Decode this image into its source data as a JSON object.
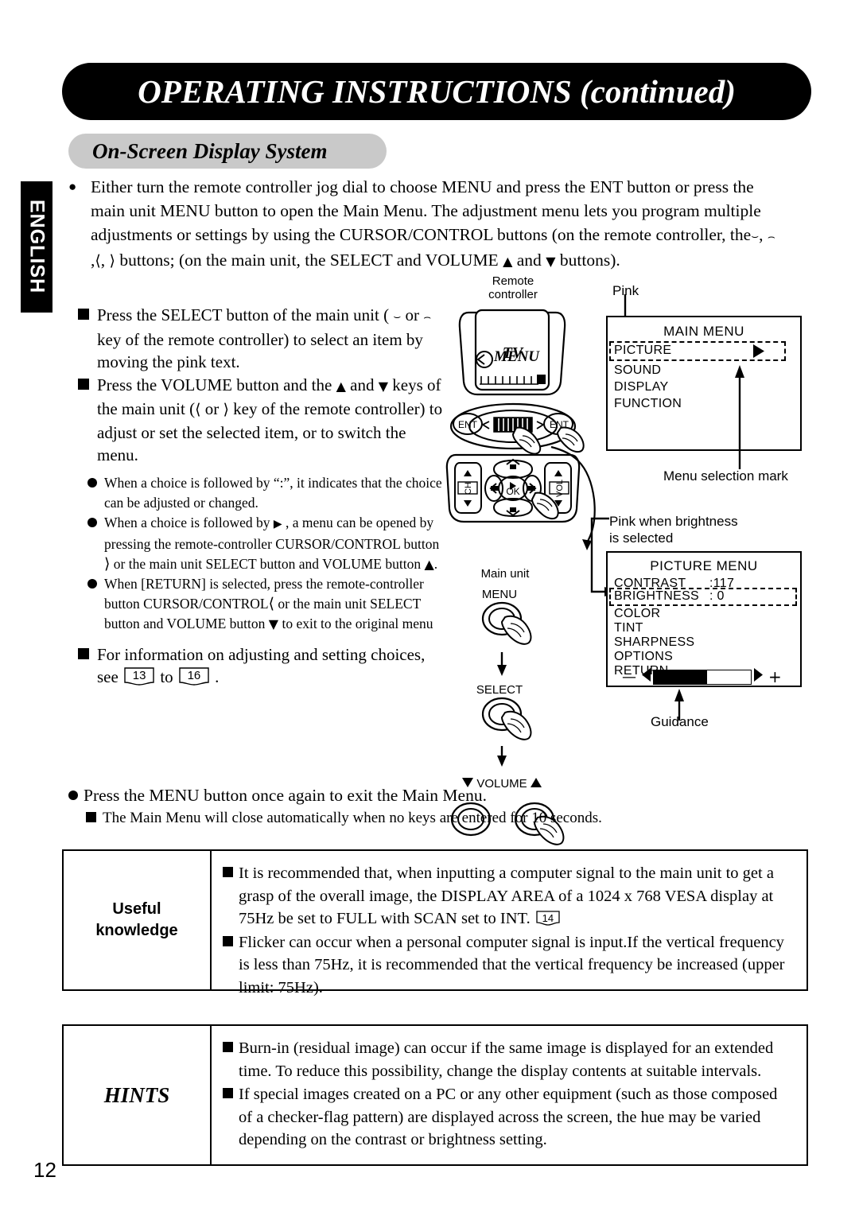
{
  "header": {
    "title_main": "OPERATING INSTRUCTIONS",
    "title_continued": " (continued)",
    "section_title": "On-Screen Display System",
    "language_tab": "ENGLISH",
    "page_number": "12"
  },
  "intro": {
    "line1": "Either turn the remote controller jog dial to choose  MENU and press the ENT button or press the",
    "line2": "main unit MENU button to open the Main Menu.  The adjustment menu lets you program multiple",
    "line3_a": "adjustments or settings by using the CURSOR/CONTROL buttons (on the remote controller, the",
    "line3_b": ",",
    "line4_a": ",",
    "line4_b": ", ",
    "line4_c": " buttons; (on the main unit, the SELECT and VOLUME ",
    "line4_d": " and ",
    "line4_e": " buttons)."
  },
  "left_column": {
    "item1": "Press the SELECT button of the main unit ( ⌒ or ⌄ key of the remote controller) to select an item by moving the pink text.",
    "item1_p1": "Press the SELECT button of the main unit ( ",
    "item1_p2": " or ",
    "item1_p3": " key of the remote controller) to select an item by moving the pink text.",
    "item2_p1": "Press the VOLUME button and the ",
    "item2_p2": " and ",
    "item2_p3": " keys of the main unit (",
    "item2_p4": " or ",
    "item2_p5": " key of the remote controller) to adjust or set the selected item, or to switch the menu.",
    "sub1": "When a choice is followed by “:”, it indicates that the choice can be adjusted or changed.",
    "sub2_p1": "When a choice is followed by ",
    "sub2_p2": " , a menu can be opened by pressing the remote-controller CURSOR/CONTROL button ",
    "sub2_p3": " or the main unit SELECT button and VOLUME button ",
    "sub2_p4": ".",
    "sub3_p1": "When [RETURN] is selected, press the remote-controller button CURSOR/CONTROL",
    "sub3_p2": " or the main unit SELECT button and VOLUME button ",
    "sub3_p3": " to exit to the original menu",
    "item3_p1": "For information on adjusting and setting choices, see ",
    "item3_ref1": "13",
    "item3_mid": " to ",
    "item3_ref2": "16",
    "item3_p2": " ."
  },
  "diagram": {
    "remote_label_line1": "Remote",
    "remote_label_line2": "controller",
    "remote_screen_tv": "TV",
    "remote_screen_menu": "MENU",
    "btn_ent_left": "ENT",
    "btn_ent_right": "ENT",
    "btn_ch": "CH",
    "btn_vol": "VOL",
    "btn_ok": "OK",
    "main_unit_label": "Main unit",
    "main_menu_btn": "MENU",
    "main_select_btn": "SELECT",
    "main_volume_btn": "VOLUME"
  },
  "osd": {
    "pink_label": "Pink",
    "menu_selection_mark_label": "Menu selection mark",
    "pink_brightness_label_line1": "Pink when brightness",
    "pink_brightness_label_line2": "is selected",
    "guidance_label": "Guidance",
    "main_menu": {
      "title": "MAIN MENU",
      "items": [
        "PICTURE",
        "SOUND",
        "DISPLAY",
        "FUNCTION"
      ],
      "selected_index": 0,
      "selected_has_arrow": true
    },
    "picture_menu": {
      "title": "PICTURE MENU",
      "rows": [
        {
          "name": "CONTRAST",
          "value": ":117"
        },
        {
          "name": "BRIGHTNESS",
          "value": ":   0"
        },
        {
          "name": "COLOR",
          "value": ""
        },
        {
          "name": "TINT",
          "value": ""
        },
        {
          "name": "SHARPNESS",
          "value": ""
        },
        {
          "name": "OPTIONS",
          "value": ""
        },
        {
          "name": "RETURN",
          "value": ""
        }
      ],
      "selected_index": 1,
      "slider_minus": "—",
      "slider_plus": "+",
      "slider_fill_percent": 55
    }
  },
  "exit_note": {
    "main": "Press the MENU button once again to exit the Main Menu.",
    "sub": "The Main Menu will close automatically when no keys are entered for 10 seconds."
  },
  "useful_knowledge": {
    "label_line1": "Useful",
    "label_line2": "knowledge",
    "bullet1_p1": "It is recommended that, when inputting a computer signal to the main unit to get a grasp of the overall image, the DISPLAY AREA of a 1024 x 768 VESA display at 75Hz be set to FULL with SCAN set to INT. ",
    "bullet1_ref": "14",
    "bullet2": "Flicker can occur when a personal computer signal is input.If the vertical frequency is less than 75Hz, it is recommended that the vertical frequency be increased (upper limit: 75Hz)."
  },
  "hints": {
    "label": "HINTS",
    "bullet1": "Burn-in (residual image) can occur if the same image is displayed for an extended time. To reduce this possibility, change the display contents at suitable intervals.",
    "bullet2": "If special images created on a PC or any other equipment (such as those composed of a checker-flag pattern) are displayed across the screen, the hue may be varied depending on the contrast or brightness setting."
  }
}
